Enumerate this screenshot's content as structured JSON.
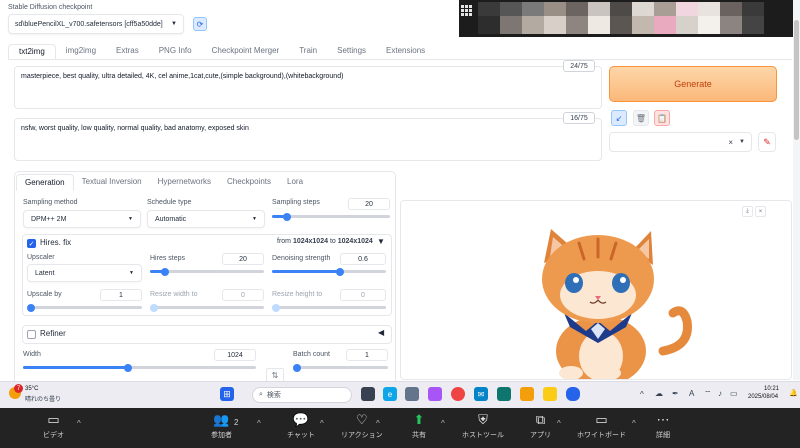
{
  "checkpoint": {
    "label": "Stable Diffusion checkpoint",
    "value": "sd\\bluePencilXL_v700.safetensors [cff5a50dde]"
  },
  "main_tabs": [
    "txt2img",
    "img2img",
    "Extras",
    "PNG Info",
    "Checkpoint Merger",
    "Train",
    "Settings",
    "Extensions"
  ],
  "prompt": {
    "text": "masterpiece, best quality, ultra detailed, 4K, cel anime,1cat,cute,(simple background),(whitebackground)",
    "counter": "24/75"
  },
  "negative_prompt": {
    "text": "nsfw, worst quality, low quality, normal quality, bad anatomy, exposed skin",
    "counter": "16/75"
  },
  "generate_label": "Generate",
  "styles_clear": "×",
  "gen_tabs": [
    "Generation",
    "Textual Inversion",
    "Hypernetworks",
    "Checkpoints",
    "Lora"
  ],
  "sampling": {
    "method_label": "Sampling method",
    "method_value": "DPM++ 2M",
    "schedule_label": "Schedule type",
    "schedule_value": "Automatic",
    "steps_label": "Sampling steps",
    "steps_value": "20",
    "steps_frac": 0.13
  },
  "hires": {
    "label": "Hires. fix",
    "size_prefix": "from",
    "size_from": "1024x1024",
    "size_mid": "to",
    "size_to": "1024x1024",
    "upscaler_label": "Upscaler",
    "upscaler_value": "Latent",
    "hires_steps_label": "Hires steps",
    "hires_steps_value": "20",
    "hires_steps_frac": 0.13,
    "denoise_label": "Denoising strength",
    "denoise_value": "0.6",
    "denoise_frac": 0.6,
    "upscale_by_label": "Upscale by",
    "upscale_by_value": "1",
    "upscale_by_frac": 0.0,
    "resize_w_label": "Resize width to",
    "resize_w_value": "0",
    "resize_h_label": "Resize height to",
    "resize_h_value": "0"
  },
  "refiner_label": "Refiner",
  "width": {
    "label": "Width",
    "value": "1024",
    "frac": 0.45
  },
  "batch": {
    "label": "Batch count",
    "value": "1",
    "frac": 0.0
  },
  "taskbar": {
    "weather_temp": "35°C",
    "weather_text": "晴れのち曇り",
    "weather_badge": "7",
    "search_placeholder": "検索",
    "time": "10:21",
    "date": "2025/08/04",
    "ime": "A"
  },
  "zoom": {
    "video": "ビデオ",
    "participants": "参加者",
    "participants_count": "2",
    "chat": "チャット",
    "reaction": "リアクション",
    "share": "共有",
    "host_tools": "ホストツール",
    "apps": "アプリ",
    "whiteboard": "ホワイトボード",
    "more": "詳細"
  },
  "colors": {
    "accent": "#2563eb",
    "generate_bg": "#fbb87a",
    "generate_text": "#c2410c",
    "zoom_bar": "#232323",
    "share_green": "#22c55e"
  }
}
